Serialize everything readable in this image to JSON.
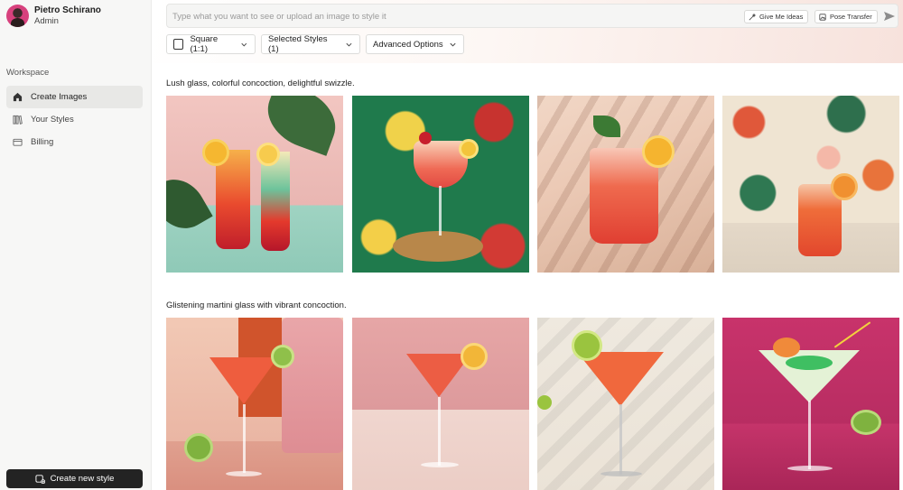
{
  "user": {
    "name": "Pietro Schirano",
    "role": "Admin"
  },
  "sidebar": {
    "section_title": "Workspace",
    "items": [
      {
        "label": "Create Images",
        "icon": "home-icon",
        "active": true
      },
      {
        "label": "Your Styles",
        "icon": "library-icon",
        "active": false
      },
      {
        "label": "Billing",
        "icon": "credit-card-icon",
        "active": false
      }
    ],
    "create_button": "Create new style"
  },
  "prompt": {
    "placeholder": "Type what you want to see or upload an image to style it",
    "ideas_button": "Give Me Ideas",
    "pose_button": "Pose Transfer"
  },
  "controls": {
    "aspect": "Square (1:1)",
    "styles": "Selected Styles (1)",
    "advanced": "Advanced Options"
  },
  "sections": [
    {
      "title": "Lush glass, colorful concoction, delightful swizzle."
    },
    {
      "title": "Glistening martini glass with vibrant concoction."
    }
  ],
  "colors": {
    "accent_dark": "#232323",
    "active_nav": "#e8e8e6"
  }
}
